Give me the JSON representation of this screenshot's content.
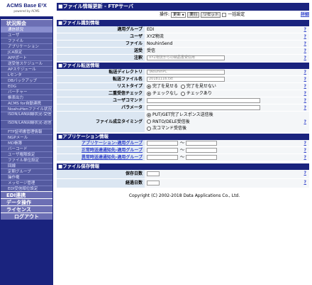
{
  "logo": {
    "title": "ACMS Base E²X",
    "subtitle": "powered by ACMS"
  },
  "sidebar": {
    "section_status": "状況照会",
    "items": [
      "通信状況",
      "ユーザ",
      "ファイル",
      "アプリケーション",
      "JCA設定",
      "APPポート",
      "送受信スケジュール",
      "APスケジュール",
      "Lセンタ",
      "DBバックアップ",
      "EDG",
      "バーチャー",
      "帳表出力",
      "ACMS for自動連携",
      "NoahuHenファイル状況",
      "ISDN/LAN回線状況-受信",
      "ISDN/LAN回線状況-送信",
      "FTP証明書管理情報",
      "NGPメール",
      "MD帳簿",
      "バーコード",
      "ユーザ権限設定",
      "ファイル単位設定",
      "回線",
      "定期グループ",
      "操作権",
      "メッセージ管理",
      "EDI受信順位設定"
    ],
    "section_edi": "EDI連携",
    "section_data": "データ操作",
    "section_license": "ライセンス",
    "logout": "ログアウト"
  },
  "header": {
    "title": "■ファイル情報更新 - FTPサーバ",
    "op_label": "操作:",
    "op_select": "更新",
    "run_btn": "実行",
    "reset_btn": "リセット",
    "bulk_label": "一括設定",
    "detail_link": "詳細"
  },
  "sections": {
    "identity": "■ファイル識別情報",
    "transfer": "■ファイル転送情報",
    "application": "■アプリケーション情報",
    "retention": "■ファイル保存情報"
  },
  "identity": {
    "group_label": "適用グループ",
    "group_value": "EDI",
    "user_label": "ユーザ",
    "user_value": "XYZ物流",
    "file_label": "ファイル",
    "file_value": "NouhinSend",
    "direction_label": "送受",
    "direction_value": "受信",
    "note_label": "注釈",
    "note_value": "XYZ物流からの納品書受信用"
  },
  "transfer": {
    "dir_label": "転送ディレクトリ",
    "dir_value": "\\NouhinPC",
    "name_label": "転送ファイル名",
    "name_value": "20181116.txt",
    "list_label": "リストタイプ",
    "list_opt1": "完了を見せる",
    "list_opt2": "完了を見せない",
    "dup_label": "二重受信チェック",
    "dup_opt1": "チェックなし",
    "dup_opt2": "チェックあり",
    "usercmd_label": "ユーザコマンド",
    "param_label": "パラメータ",
    "timing_label": "ファイル成立タイミング",
    "timing_opt1": "PUT/GET完了レスポンス送信後",
    "timing_opt2": "RNTO/DELE受信後",
    "timing_opt3": "次コマンド受信後"
  },
  "application": {
    "group_label": "アプリケーション-適用グループ",
    "normal_label": "正常時送達通知先-適用グループ",
    "error_label": "異常時送達通知先-適用グループ",
    "tilde": "～"
  },
  "retention": {
    "keep_label": "保存日数",
    "elapsed_label": "経過日数"
  },
  "help": "?",
  "footer": {
    "copyright": "Copyright (C) 2002-2018 Data Applications Co., Ltd."
  }
}
